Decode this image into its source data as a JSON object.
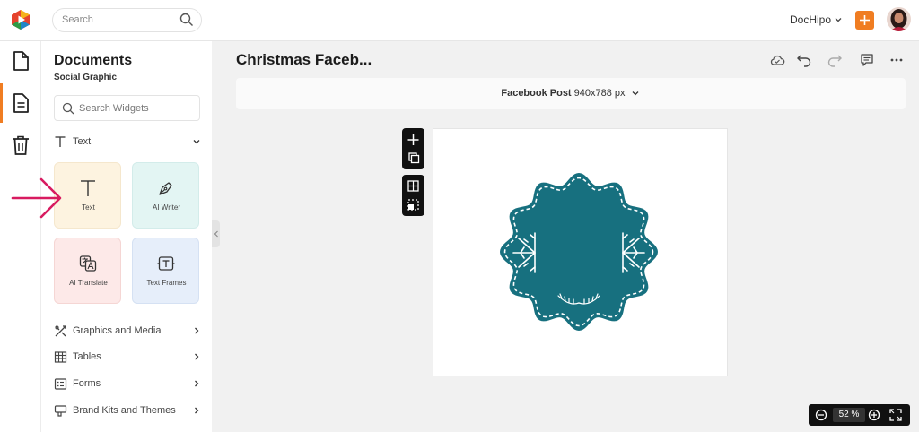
{
  "header": {
    "search_placeholder": "Search",
    "brand_name": "DocHipo",
    "accent_color": "#f07d22"
  },
  "rail": {
    "items": [
      {
        "icon": "document-icon"
      },
      {
        "icon": "page-widgets-icon",
        "active": true
      },
      {
        "icon": "trash-icon"
      }
    ]
  },
  "panel": {
    "title": "Documents",
    "subtitle": "Social Graphic",
    "search_placeholder": "Search Widgets",
    "text_section": "Text",
    "tiles": {
      "text": "Text",
      "ai_writer": "AI Writer",
      "ai_translate": "AI Translate",
      "text_frames": "Text Frames"
    },
    "sections": {
      "graphics": "Graphics and Media",
      "tables": "Tables",
      "forms": "Forms",
      "brand": "Brand Kits and Themes"
    }
  },
  "main": {
    "doc_title": "Christmas Faceb...",
    "size_type": "Facebook Post",
    "size_dims": "940x788 px",
    "badge_color": "#17707f"
  },
  "zoom": {
    "value": "52",
    "unit": "%"
  }
}
